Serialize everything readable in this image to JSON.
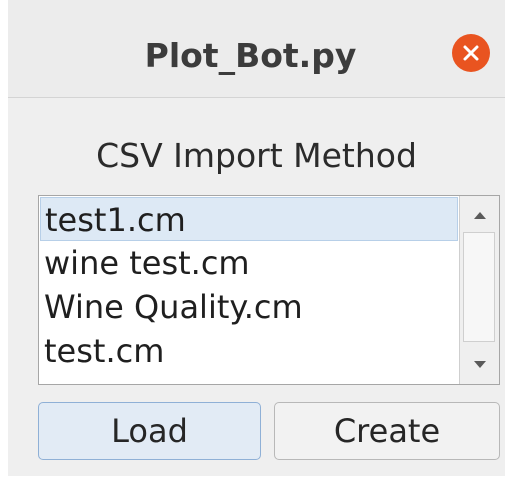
{
  "window": {
    "title": "Plot_Bot.py",
    "close_icon": "close-icon",
    "accent_close": "#e95420"
  },
  "main": {
    "heading": "CSV Import Method",
    "list": {
      "items": [
        {
          "label": "test1.cm",
          "selected": true
        },
        {
          "label": "wine test.cm",
          "selected": false
        },
        {
          "label": "Wine Quality.cm",
          "selected": false
        },
        {
          "label": "test.cm",
          "selected": false
        }
      ]
    },
    "buttons": {
      "load_label": "Load",
      "create_label": "Create"
    }
  }
}
